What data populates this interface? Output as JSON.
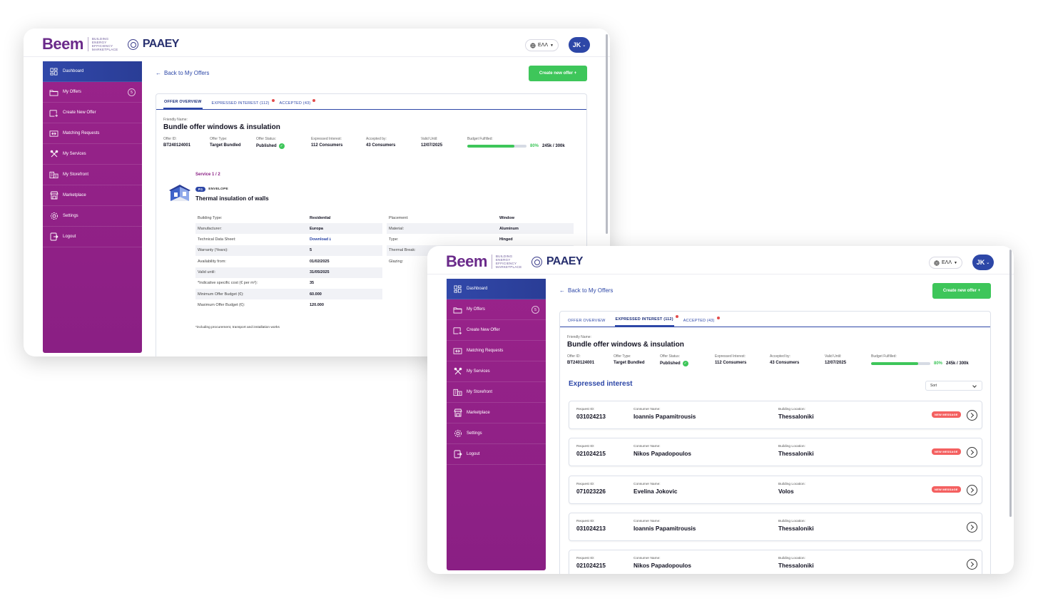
{
  "brand": {
    "logo_main": "Beem",
    "logo_sub": "BUILDING ENERGY EFFICIENCY MARKETPLACE",
    "partner_logo": "PAAEY"
  },
  "header": {
    "language": "ΕΛΛ",
    "user_initials": "JK"
  },
  "sidebar": {
    "items": [
      {
        "label": "Dashboard",
        "icon": "dashboard-icon",
        "active": true
      },
      {
        "label": "My Offers",
        "icon": "folder-icon",
        "badge": "5"
      },
      {
        "label": "Create New Offer",
        "icon": "create-offer-icon"
      },
      {
        "label": "Matching Requests",
        "icon": "matching-icon"
      },
      {
        "label": "My Services",
        "icon": "tools-icon"
      },
      {
        "label": "My Storefront",
        "icon": "building-icon"
      },
      {
        "label": "Marketplace",
        "icon": "store-icon"
      },
      {
        "label": "Settings",
        "icon": "gear-icon"
      },
      {
        "label": "Logout",
        "icon": "logout-icon"
      }
    ]
  },
  "nav": {
    "back_label": "Back to My Offers",
    "create_label": "Create new offer +"
  },
  "tabs": {
    "overview": "OFFER OVERVIEW",
    "interest": "EXPRESSED INTEREST (112)",
    "accepted": "ACCEPTED (43)"
  },
  "offer": {
    "friendly_name_label": "Friendly Name:",
    "friendly_name": "Bundle offer windows & insulation",
    "meta": [
      {
        "label": "Offer ID:",
        "value": "BT240124001"
      },
      {
        "label": "Offer Type:",
        "value": "Target Bundled"
      },
      {
        "label": "Offer Status:",
        "value": "Published"
      },
      {
        "label": "Expressed Interest:",
        "value": "112 Consumers"
      },
      {
        "label": "Accepted by:",
        "value": "43 Consumers"
      },
      {
        "label": "Valid Until:",
        "value": "12/07/2025"
      },
      {
        "label": "Budget Fulfilled:",
        "value": ""
      }
    ],
    "budget_progress": 80,
    "budget_pct_label": "80%",
    "budget_amount": "245k / 300k"
  },
  "service": {
    "count": "Service 1 / 2",
    "code": "P.1",
    "category": "ENVELOPE",
    "name": "Thermal insulation of walls",
    "specs_left": [
      {
        "k": "Building Type:",
        "v": "Residential"
      },
      {
        "k": "Manufacturer:",
        "v": "Europa"
      },
      {
        "k": "Technical Data Sheet:",
        "v": "Download ⭳"
      },
      {
        "k": "Warranty (Years):",
        "v": "5"
      },
      {
        "k": "Availability from:",
        "v": "01/02/2025"
      },
      {
        "k": "Valid until:",
        "v": "31/05/2025"
      },
      {
        "k": "*Indicative specific cost (€ per m²):",
        "v": "35"
      },
      {
        "k": "Minimum Offer Budget (€):",
        "v": "60.000"
      },
      {
        "k": "Maximum Offer Budget (€):",
        "v": "120.000"
      }
    ],
    "specs_right": [
      {
        "k": "Placement:",
        "v": "Window"
      },
      {
        "k": "Material:",
        "v": "Aluminum"
      },
      {
        "k": "Type:",
        "v": "Hinged"
      },
      {
        "k": "Thermal Break:",
        "v": ""
      },
      {
        "k": "Glazing:",
        "v": ""
      }
    ],
    "footnote": "*including procurement, transport and installation works"
  },
  "interest": {
    "title": "Expressed interest",
    "sort_label": "Sort",
    "labels": {
      "request_id": "Request ID:",
      "consumer": "Consumer Name:",
      "location": "Building Location:"
    },
    "new_message_label": "NEW MESSAGE",
    "rows": [
      {
        "id": "031024213",
        "name": "Ioannis Papamitrousis",
        "location": "Thessaloniki",
        "new_message": true
      },
      {
        "id": "021024215",
        "name": "Nikos Papadopoulos",
        "location": "Thessaloniki",
        "new_message": true
      },
      {
        "id": "071023226",
        "name": "Evelina Jokovic",
        "location": "Volos",
        "new_message": true
      },
      {
        "id": "031024213",
        "name": "Ioannis Papamitrousis",
        "location": "Thessaloniki",
        "new_message": false
      },
      {
        "id": "021024215",
        "name": "Nikos Papadopoulos",
        "location": "Thessaloniki",
        "new_message": false
      }
    ]
  },
  "colors": {
    "sidebar": "#8a1f84",
    "active": "#2d47a7",
    "primary_button": "#3ec65a",
    "badge_red": "#f46060"
  }
}
